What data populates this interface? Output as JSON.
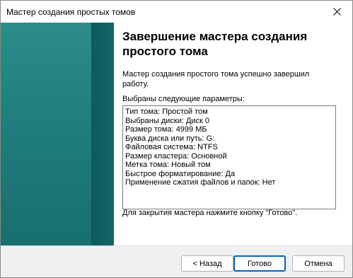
{
  "window": {
    "title": "Мастер создания простых томов"
  },
  "content": {
    "heading": "Завершение мастера создания простого тома",
    "intro": "Мастер создания простого тома успешно завершил работу.",
    "params_label": "Выбраны следующие параметры:",
    "params": [
      "Тип тома: Простой том",
      "Выбраны диски: Диск 0",
      "Размер тома: 4999 МБ",
      "Буква диска или путь: G:",
      "Файловая система: NTFS",
      "Размер кластера: Основной",
      "Метка тома: Новый том",
      "Быстрое форматирование: Да",
      "Применение сжатия файлов и папок: Нет"
    ],
    "finish_note": "Для закрытия мастера нажмите кнопку \"Готово\"."
  },
  "buttons": {
    "back": "< Назад",
    "finish": "Готово",
    "cancel": "Отмена"
  },
  "icons": {
    "close": "close-icon"
  },
  "colors": {
    "banner": "#146a69",
    "default_button_border": "#0067c0",
    "footer_bg": "#f0f0f0"
  }
}
